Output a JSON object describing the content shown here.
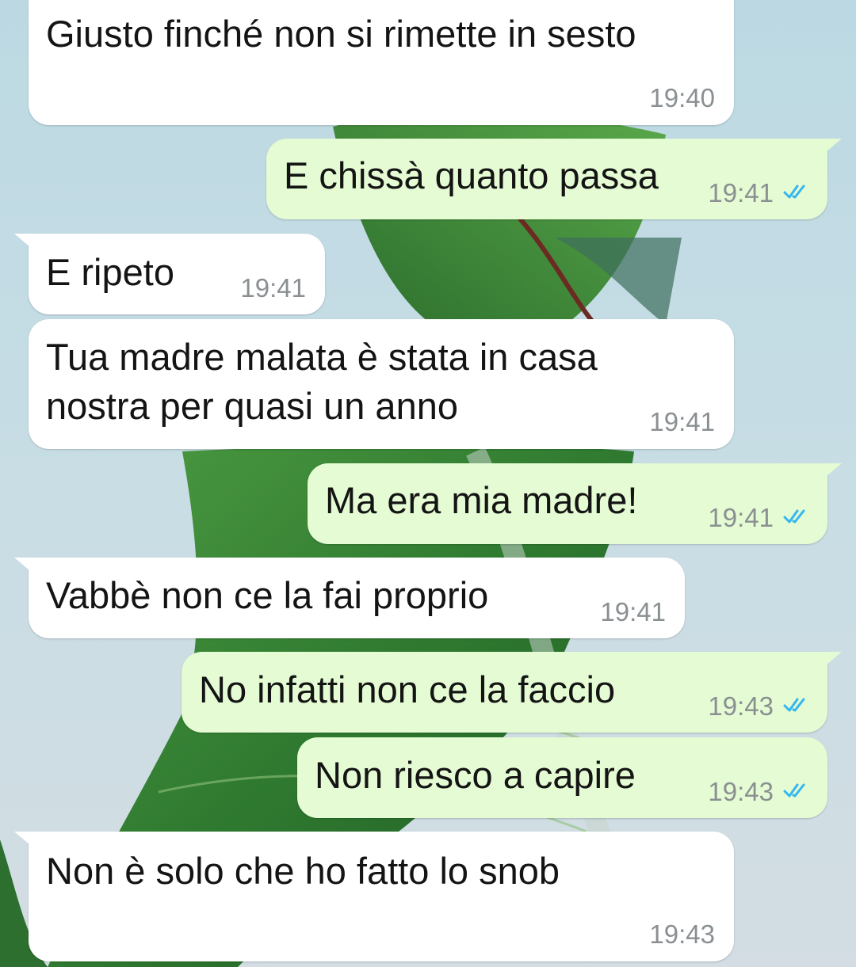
{
  "chat": {
    "messages": [
      {
        "direction": "incoming",
        "text": "Giusto finché non si rimette in sesto",
        "time": "19:40"
      },
      {
        "direction": "outgoing",
        "text": "E chissà quanto passa",
        "time": "19:41",
        "status": "read"
      },
      {
        "direction": "incoming",
        "text": "E ripeto",
        "time": "19:41"
      },
      {
        "direction": "incoming",
        "lines": [
          "Tua madre malata è stata in casa",
          "nostra per quasi un anno"
        ],
        "time": "19:41"
      },
      {
        "direction": "outgoing",
        "text": "Ma era mia madre!",
        "time": "19:41",
        "status": "read"
      },
      {
        "direction": "incoming",
        "text": "Vabbè non ce la fai proprio",
        "time": "19:41"
      },
      {
        "direction": "outgoing",
        "text": "No infatti non ce la faccio",
        "time": "19:43",
        "status": "read"
      },
      {
        "direction": "outgoing",
        "text": "Non riesco a capire",
        "time": "19:43",
        "status": "read"
      },
      {
        "direction": "incoming",
        "text": "Non è solo che ho fatto lo snob",
        "time": "19:43"
      }
    ]
  },
  "colors": {
    "incoming_bubble": "#ffffff",
    "outgoing_bubble": "#e4fbd3",
    "read_check": "#34b7f1",
    "timestamp": "#8a8f92",
    "wallpaper_sky": "#c9dfe6",
    "wallpaper_leaf": "#3c8a3a"
  },
  "icons": {
    "read_receipt": "double-check-icon"
  }
}
